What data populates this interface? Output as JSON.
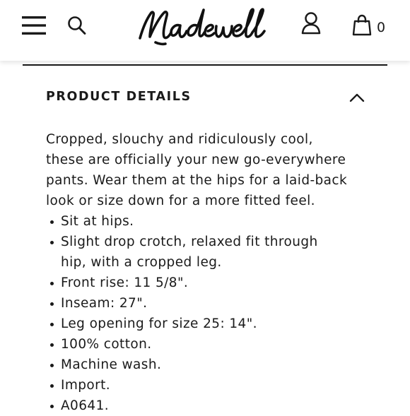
{
  "header": {
    "brand": "Madewell",
    "bag_count": "0"
  },
  "icons": {
    "menu": "hamburger-menu-icon",
    "search": "search-icon",
    "account": "account-icon",
    "bag": "shopping-bag-icon",
    "toggle": "chevron-up-icon"
  },
  "product_details": {
    "title": "PRODUCT DETAILS",
    "description_lines": [
      "Cropped, slouchy and ridiculously cool,",
      "these are officially your new go-everywhere",
      "pants. Wear them at the hips for a laid-back",
      "look or size down for a more fitted feel."
    ],
    "bullets": [
      [
        "Sit at hips."
      ],
      [
        "Slight drop crotch, relaxed fit through",
        "hip, with a cropped leg."
      ],
      [
        "Front rise: 11 5/8\"."
      ],
      [
        "Inseam: 27\"."
      ],
      [
        "Leg opening for size 25: 14\"."
      ],
      [
        "100% cotton."
      ],
      [
        "Machine wash."
      ],
      [
        "Import."
      ],
      [
        "A0641."
      ]
    ]
  },
  "colors": {
    "text": "#1a1a1a",
    "background": "#ffffff"
  }
}
